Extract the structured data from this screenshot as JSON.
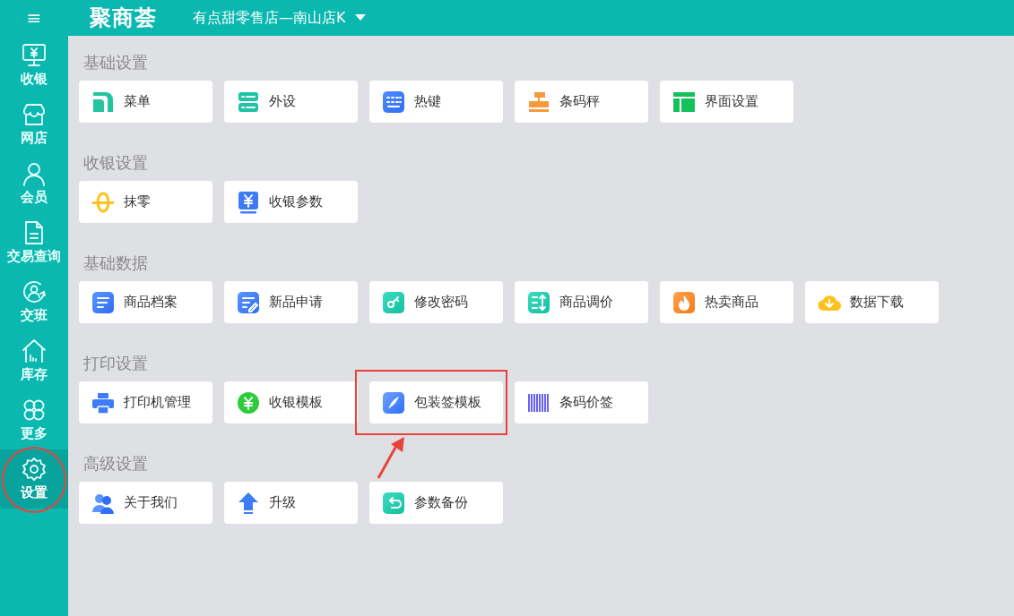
{
  "topbar": {
    "menu_glyph": "≡",
    "logo": "聚商荟",
    "store": "有点甜零售店—南山店K"
  },
  "sidebar": {
    "items": [
      {
        "label": "收银",
        "selected": false,
        "circled": false
      },
      {
        "label": "网店",
        "selected": false,
        "circled": false
      },
      {
        "label": "会员",
        "selected": false,
        "circled": false
      },
      {
        "label": "交易查询",
        "selected": false,
        "circled": false
      },
      {
        "label": "交班",
        "selected": false,
        "circled": false
      },
      {
        "label": "库存",
        "selected": false,
        "circled": false
      },
      {
        "label": "更多",
        "selected": false,
        "circled": false
      },
      {
        "label": "设置",
        "selected": true,
        "circled": true
      }
    ]
  },
  "sections": [
    {
      "title": "基础设置",
      "tiles": [
        {
          "label": "菜单",
          "highlighted": false
        },
        {
          "label": "外设",
          "highlighted": false
        },
        {
          "label": "热键",
          "highlighted": false
        },
        {
          "label": "条码秤",
          "highlighted": false
        },
        {
          "label": "界面设置",
          "highlighted": false
        }
      ]
    },
    {
      "title": "收银设置",
      "tiles": [
        {
          "label": "抹零",
          "highlighted": false
        },
        {
          "label": "收银参数",
          "highlighted": false
        }
      ]
    },
    {
      "title": "基础数据",
      "tiles": [
        {
          "label": "商品档案",
          "highlighted": false
        },
        {
          "label": "新品申请",
          "highlighted": false
        },
        {
          "label": "修改密码",
          "highlighted": false
        },
        {
          "label": "商品调价",
          "highlighted": false
        },
        {
          "label": "热卖商品",
          "highlighted": false
        },
        {
          "label": "数据下载",
          "highlighted": false
        }
      ]
    },
    {
      "title": "打印设置",
      "tiles": [
        {
          "label": "打印机管理",
          "highlighted": false
        },
        {
          "label": "收银模板",
          "highlighted": false
        },
        {
          "label": "包装签模板",
          "highlighted": true
        },
        {
          "label": "条码价签",
          "highlighted": false
        }
      ]
    },
    {
      "title": "高级设置",
      "tiles": [
        {
          "label": "关于我们",
          "highlighted": false
        },
        {
          "label": "升级",
          "highlighted": false
        },
        {
          "label": "参数备份",
          "highlighted": false
        }
      ]
    }
  ]
}
